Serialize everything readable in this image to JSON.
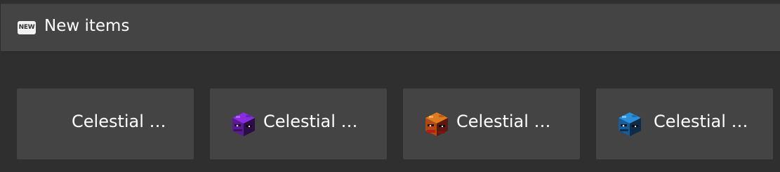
{
  "header": {
    "badge_text": "NEW",
    "title": "New items"
  },
  "items": [
    {
      "label": "Celestial …",
      "icon": "none",
      "accent": ""
    },
    {
      "label": "Celestial …",
      "icon": "purple-helmet-icon",
      "accent": "#8a2be2"
    },
    {
      "label": "Celestial …",
      "icon": "orange-helmet-icon",
      "accent": "#e07a1f"
    },
    {
      "label": "Celestial …",
      "icon": "blue-helmet-icon",
      "accent": "#2a8fd6"
    }
  ]
}
